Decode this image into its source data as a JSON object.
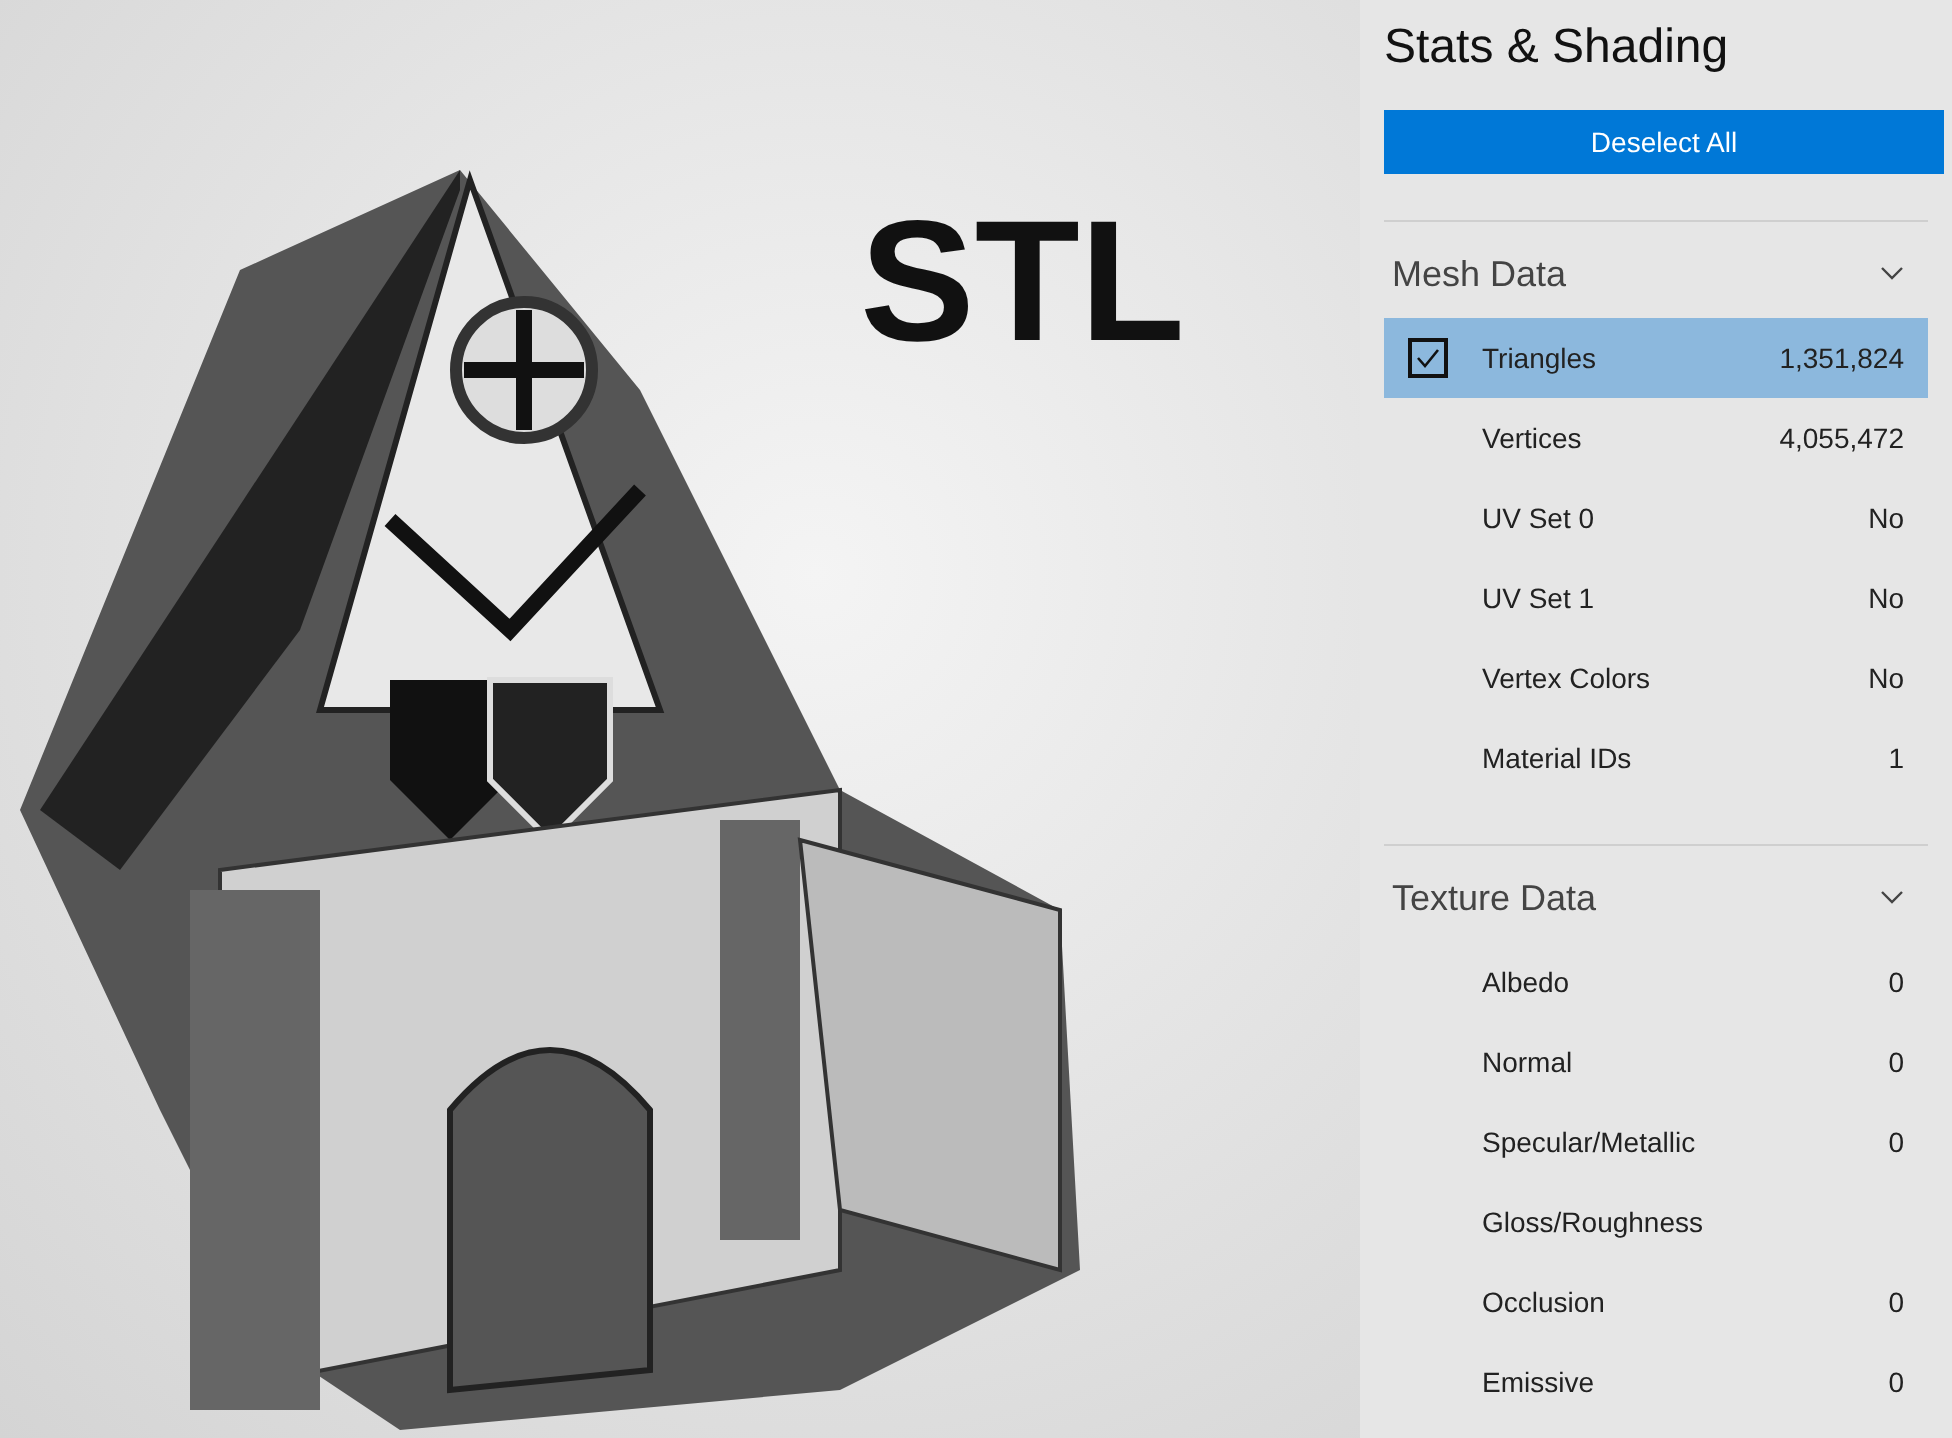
{
  "viewport": {
    "overlay_label": "STL"
  },
  "panel": {
    "title": "Stats & Shading",
    "deselect_button": "Deselect All",
    "sections": [
      {
        "title": "Mesh Data",
        "expanded": true,
        "rows": [
          {
            "label": "Triangles",
            "value": "1,351,824",
            "selected": true
          },
          {
            "label": "Vertices",
            "value": "4,055,472",
            "selected": false
          },
          {
            "label": "UV Set 0",
            "value": "No",
            "selected": false
          },
          {
            "label": "UV Set 1",
            "value": "No",
            "selected": false
          },
          {
            "label": "Vertex Colors",
            "value": "No",
            "selected": false
          },
          {
            "label": "Material IDs",
            "value": "1",
            "selected": false
          }
        ]
      },
      {
        "title": "Texture Data",
        "expanded": true,
        "rows": [
          {
            "label": "Albedo",
            "value": "0",
            "selected": false
          },
          {
            "label": "Normal",
            "value": "0",
            "selected": false
          },
          {
            "label": "Specular/Metallic",
            "value": "0",
            "selected": false
          },
          {
            "label": "Gloss/Roughness",
            "selected": false
          },
          {
            "label": "Occlusion",
            "value": "0",
            "selected": false
          },
          {
            "label": "Emissive",
            "value": "0",
            "selected": false
          }
        ]
      }
    ]
  }
}
